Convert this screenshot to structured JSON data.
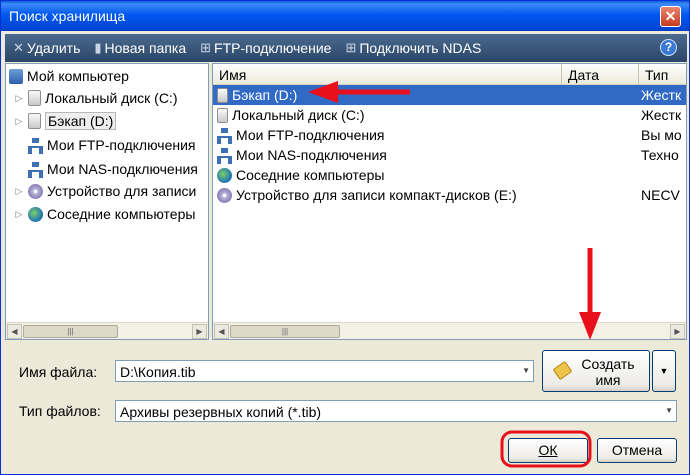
{
  "window": {
    "title": "Поиск хранилища",
    "close_label": "✕"
  },
  "toolbar": {
    "delete_label": "Удалить",
    "new_folder_label": "Новая папка",
    "ftp_label": "FTP-подключение",
    "ndas_label": "Подключить NDAS",
    "help_label": "?"
  },
  "tree": {
    "items": [
      {
        "label": "Мой компьютер",
        "icon": "computer-icon"
      },
      {
        "label": "Локальный диск (C:)",
        "icon": "disk-icon"
      },
      {
        "label": "Бэкап (D:)",
        "icon": "disk-icon",
        "selected": true
      },
      {
        "label": "Мои FTP-подключения",
        "icon": "ftp-icon"
      },
      {
        "label": "Мои NAS-подключения",
        "icon": "nas-icon"
      },
      {
        "label": "Устройство для записи",
        "icon": "cd-icon"
      },
      {
        "label": "Соседние компьютеры",
        "icon": "network-icon"
      }
    ]
  },
  "list": {
    "columns": [
      "Имя",
      "Дата",
      "Тип"
    ],
    "rows": [
      {
        "name": "Бэкап (D:)",
        "type": "Жестк",
        "icon": "disk-icon"
      },
      {
        "name": "Локальный диск (C:)",
        "type": "Жестк",
        "icon": "disk-icon"
      },
      {
        "name": "Мои FTP-подключения",
        "type": "Вы мо",
        "icon": "ftp-icon"
      },
      {
        "name": "Мои NAS-подключения",
        "type": "Техно",
        "icon": "nas-icon"
      },
      {
        "name": "Соседние компьютеры",
        "type": "",
        "icon": "network-icon"
      },
      {
        "name": "Устройство для записи компакт-дисков (E:)",
        "type": "NECV",
        "icon": "cd-icon"
      }
    ]
  },
  "form": {
    "filename_label": "Имя файла:",
    "filename_value": "D:\\Копия.tib",
    "filetype_label": "Тип файлов:",
    "filetype_value": "Архивы резервных копий (*.tib)",
    "generate_label_line1": "Создать",
    "generate_label_line2": "имя"
  },
  "buttons": {
    "ok_label": "ОК",
    "cancel_label": "Отмена"
  },
  "colors": {
    "annotation": "#e8101a",
    "selection": "#316ac5"
  }
}
